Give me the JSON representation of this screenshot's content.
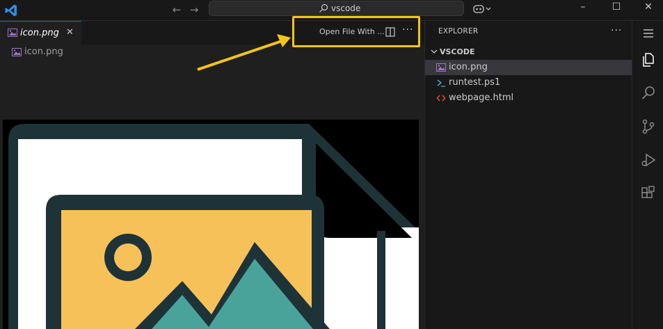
{
  "titlebar": {
    "search_text": "vscode",
    "window_controls": [
      "minimize",
      "maximize",
      "close"
    ]
  },
  "editor": {
    "active_tab_label": "icon.png",
    "breadcrumb_label": "icon.png",
    "open_with_label": "Open File With ...",
    "more_actions": "···"
  },
  "explorer": {
    "title": "EXPLORER",
    "more_actions": "···",
    "folder_name": "VSCODE",
    "files": [
      {
        "label": "icon.png",
        "icon": "image-file-icon",
        "selected": true
      },
      {
        "label": "runtest.ps1",
        "icon": "powershell-file-icon",
        "selected": false
      },
      {
        "label": "webpage.html",
        "icon": "html-file-icon",
        "selected": false
      }
    ]
  },
  "activity_bar": [
    "explorer-icon",
    "search-icon",
    "source-control-icon",
    "run-debug-icon",
    "extensions-icon",
    "menu-icon"
  ],
  "colors": {
    "accent": "#0078d4",
    "highlight_annotation": "#f5c518",
    "image_file_icon": "#a074c4",
    "powershell_icon": "#519aba",
    "html_icon": "#e44d26"
  }
}
